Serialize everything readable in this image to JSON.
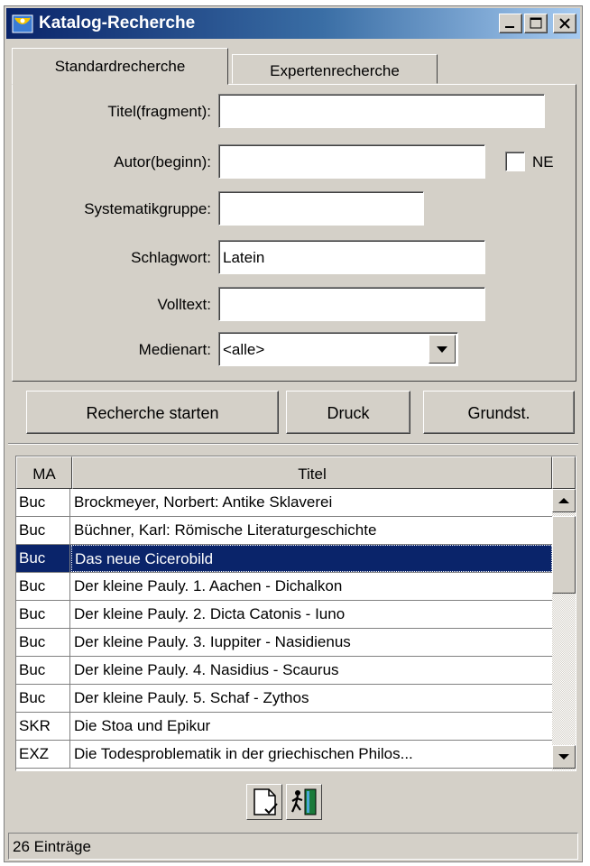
{
  "window": {
    "title": "Katalog-Recherche",
    "icons": {
      "app": "catalog-app-icon",
      "minimize": "minimize-icon",
      "maximize": "maximize-icon",
      "close": "close-icon"
    }
  },
  "tabs": [
    {
      "label": "Standardrecherche",
      "active": true
    },
    {
      "label": "Expertenrecherche",
      "active": false
    }
  ],
  "form": {
    "titel_label": "Titel(fragment):",
    "titel_value": "",
    "autor_label": "Autor(beginn):",
    "autor_value": "",
    "ne_label": "NE",
    "ne_checked": false,
    "systematik_label": "Systematikgruppe:",
    "systematik_value": "",
    "schlagwort_label": "Schlagwort:",
    "schlagwort_value": "Latein",
    "volltext_label": "Volltext:",
    "volltext_value": "",
    "medienart_label": "Medienart:",
    "medienart_value": "<alle>"
  },
  "buttons": {
    "search": "Recherche starten",
    "print": "Druck",
    "reset": "Grundst."
  },
  "table": {
    "columns": [
      "MA",
      "Titel"
    ],
    "rows": [
      {
        "ma": "Buc",
        "titel": "Brockmeyer, Norbert: Antike Sklaverei"
      },
      {
        "ma": "Buc",
        "titel": "Büchner, Karl: Römische Literaturgeschichte"
      },
      {
        "ma": "Buc",
        "titel": "Das neue Cicerobild"
      },
      {
        "ma": "Buc",
        "titel": "Der kleine Pauly. 1. Aachen - Dichalkon"
      },
      {
        "ma": "Buc",
        "titel": "Der kleine Pauly. 2. Dicta Catonis - Iuno"
      },
      {
        "ma": "Buc",
        "titel": "Der kleine Pauly. 3. Iuppiter - Nasidienus"
      },
      {
        "ma": "Buc",
        "titel": "Der kleine Pauly. 4. Nasidius - Scaurus"
      },
      {
        "ma": "Buc",
        "titel": "Der kleine Pauly. 5. Schaf - Zythos"
      },
      {
        "ma": "SKR",
        "titel": "Die Stoa und Epikur"
      },
      {
        "ma": "EXZ",
        "titel": "Die Todesproblematik in der griechischen Philos..."
      }
    ],
    "selected_index": 2
  },
  "toolbar_icons": [
    "document-check-icon",
    "exit-door-icon"
  ],
  "colors": {
    "selection": "#0a246a",
    "titlebar": "#0a246a",
    "face": "#d4d0c8"
  },
  "status": "26 Einträge"
}
